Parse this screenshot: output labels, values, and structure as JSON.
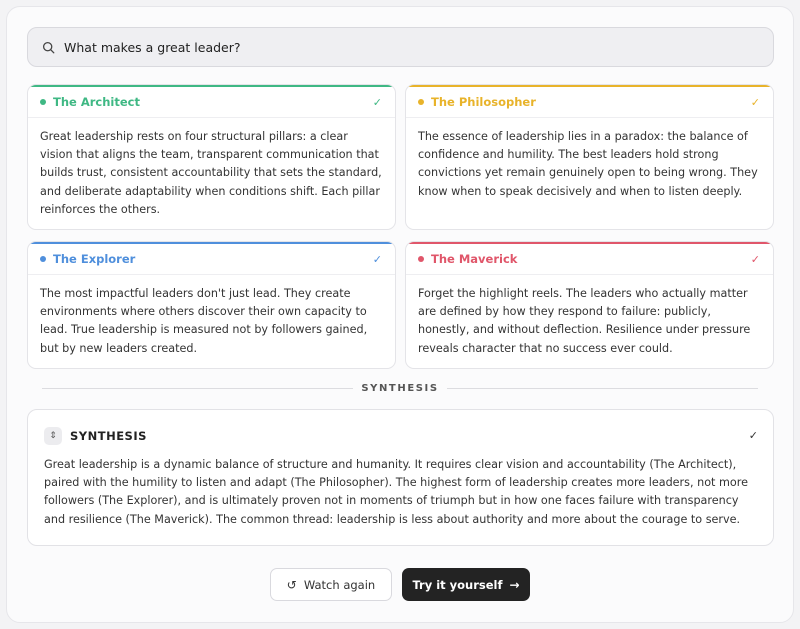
{
  "search": {
    "query": "What makes a great leader?"
  },
  "cards": [
    {
      "title": "The Architect",
      "color": "#3fb884",
      "body": "Great leadership rests on four structural pillars: a clear vision that aligns the team, transparent communication that builds trust, consistent accountability that sets the standard, and deliberate adaptability when conditions shift. Each pillar reinforces the others."
    },
    {
      "title": "The Philosopher",
      "color": "#e8b32a",
      "body": "The essence of leadership lies in a paradox: the balance of confidence and humility. The best leaders hold strong convictions yet remain genuinely open to being wrong. They know when to speak decisively and when to listen deeply."
    },
    {
      "title": "The Explorer",
      "color": "#4f8fdc",
      "body": "The most impactful leaders don't just lead. They create environments where others discover their own capacity to lead. True leadership is measured not by followers gained, but by new leaders created."
    },
    {
      "title": "The Maverick",
      "color": "#e0566a",
      "body": "Forget the highlight reels. The leaders who actually matter are defined by how they respond to failure: publicly, honestly, and without deflection. Resilience under pressure reveals character that no success ever could."
    }
  ],
  "divider_label": "SYNTHESIS",
  "synthesis": {
    "title": "SYNTHESIS",
    "body": "Great leadership is a dynamic balance of structure and humanity. It requires clear vision and accountability (The Architect), paired with the humility to listen and adapt (The Philosopher). The highest form of leadership creates more leaders, not more followers (The Explorer), and is ultimately proven not in moments of triumph but in how one faces failure with transparency and resilience (The Maverick). The common thread: leadership is less about authority and more about the courage to serve."
  },
  "buttons": {
    "watch_again": "Watch again",
    "try_it": "Try it yourself"
  }
}
